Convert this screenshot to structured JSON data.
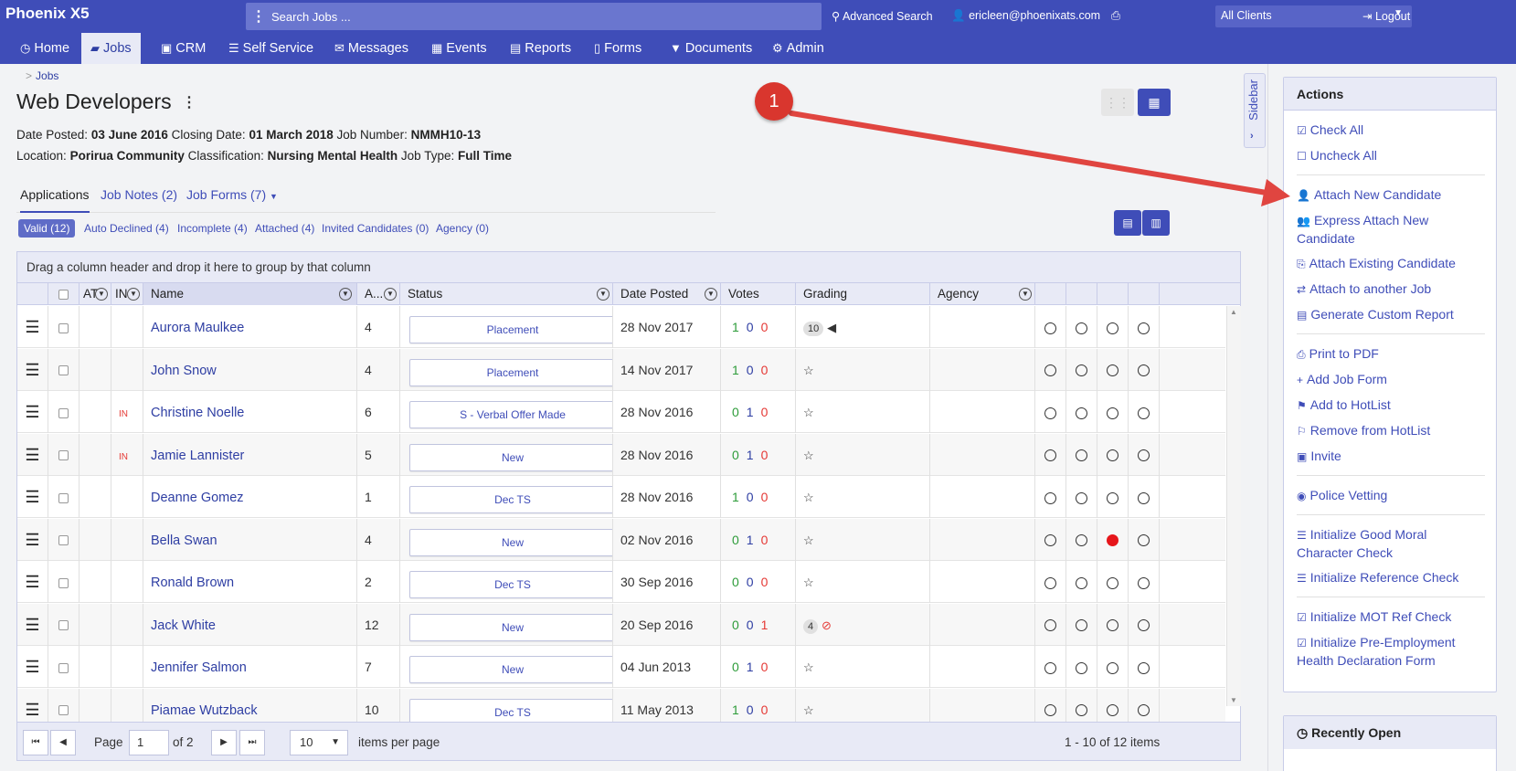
{
  "app": {
    "brand": "Phoenix X5",
    "search_placeholder": "Search Jobs ...",
    "advanced_search": "Advanced Search",
    "user": "ericleen@phoenixats.com",
    "client_select": "All Clients",
    "logout": "Logout"
  },
  "nav": [
    "Home",
    "Jobs",
    "CRM",
    "Self Service",
    "Messages",
    "Events",
    "Reports",
    "Forms",
    "Documents",
    "Admin"
  ],
  "breadcrumb": "Jobs",
  "job": {
    "title": "Web Developers",
    "date_posted_label": "Date Posted:",
    "date_posted": "03 June 2016",
    "closing_date_label": "Closing Date:",
    "closing_date": "01 March 2018",
    "job_number_label": "Job Number:",
    "job_number": "NMMH10-13",
    "location_label": "Location:",
    "location": "Porirua Community",
    "classification_label": "Classification:",
    "classification": "Nursing Mental Health",
    "job_type_label": "Job Type:",
    "job_type": "Full Time"
  },
  "sidebar_tab": "Sidebar",
  "tabs": [
    "Applications",
    "Job Notes (2)",
    "Job Forms (7)"
  ],
  "filters": [
    "Valid (12)",
    "Auto Declined (4)",
    "Incomplete (4)",
    "Attached (4)",
    "Invited Candidates (0)",
    "Agency (0)"
  ],
  "grid": {
    "group_hint": "Drag a column header and drop it here to group by that column",
    "headers": {
      "at": "AT",
      "in": "IN",
      "name": "Name",
      "a": "A...",
      "status": "Status",
      "date_posted": "Date Posted",
      "votes": "Votes",
      "grading": "Grading",
      "agency": "Agency"
    },
    "rows": [
      {
        "in": "",
        "name": "Aurora Maulkee",
        "a": "4",
        "status": "Placement",
        "date": "28 Nov 2017",
        "votes": [
          "1",
          "0",
          "0"
        ],
        "grade": "10",
        "grade_icon": "megaphone-icon",
        "radios": [
          false,
          false,
          false,
          false
        ]
      },
      {
        "in": "",
        "name": "John Snow",
        "a": "4",
        "status": "Placement",
        "date": "14 Nov 2017",
        "votes": [
          "1",
          "0",
          "0"
        ],
        "grade": "",
        "grade_icon": "star-icon",
        "radios": [
          false,
          false,
          false,
          false
        ]
      },
      {
        "in": "IN",
        "name": "Christine Noelle",
        "a": "6",
        "status": "S - Verbal Offer Made",
        "date": "28 Nov 2016",
        "votes": [
          "0",
          "1",
          "0"
        ],
        "grade": "",
        "grade_icon": "star-icon",
        "radios": [
          false,
          false,
          false,
          false
        ]
      },
      {
        "in": "IN",
        "name": "Jamie Lannister",
        "a": "5",
        "status": "New",
        "date": "28 Nov 2016",
        "votes": [
          "0",
          "1",
          "0"
        ],
        "grade": "",
        "grade_icon": "star-icon",
        "radios": [
          false,
          false,
          false,
          false
        ]
      },
      {
        "in": "",
        "name": "Deanne Gomez",
        "a": "1",
        "status": "Dec TS",
        "date": "28 Nov 2016",
        "votes": [
          "1",
          "0",
          "0"
        ],
        "grade": "",
        "grade_icon": "star-icon",
        "radios": [
          false,
          false,
          false,
          false
        ]
      },
      {
        "in": "",
        "name": "Bella Swan",
        "a": "4",
        "status": "New",
        "date": "02 Nov 2016",
        "votes": [
          "0",
          "1",
          "0"
        ],
        "grade": "",
        "grade_icon": "star-icon",
        "radios": [
          false,
          false,
          true,
          false
        ]
      },
      {
        "in": "",
        "name": "Ronald Brown",
        "a": "2",
        "status": "Dec TS",
        "date": "30 Sep 2016",
        "votes": [
          "0",
          "0",
          "0"
        ],
        "grade": "",
        "grade_icon": "star-icon",
        "radios": [
          false,
          false,
          false,
          false
        ]
      },
      {
        "in": "",
        "name": "Jack White",
        "a": "12",
        "status": "New",
        "date": "20 Sep 2016",
        "votes": [
          "0",
          "0",
          "1"
        ],
        "grade": "4",
        "grade_icon": "ban-icon",
        "radios": [
          false,
          false,
          false,
          false
        ]
      },
      {
        "in": "",
        "name": "Jennifer Salmon",
        "a": "7",
        "status": "New",
        "date": "04 Jun 2013",
        "votes": [
          "0",
          "1",
          "0"
        ],
        "grade": "",
        "grade_icon": "star-icon",
        "radios": [
          false,
          false,
          false,
          false
        ]
      },
      {
        "in": "",
        "name": "Piamae Wutzback",
        "a": "10",
        "status": "Dec TS",
        "date": "11 May 2013",
        "votes": [
          "1",
          "0",
          "0"
        ],
        "grade": "",
        "grade_icon": "star-icon",
        "radios": [
          false,
          false,
          false,
          false
        ]
      }
    ],
    "pager": {
      "page_label": "Page",
      "page": "1",
      "of": "of 2",
      "ipp": "10",
      "ipp_label": "items per page",
      "summary": "1 - 10 of 12 items"
    }
  },
  "actions": {
    "title": "Actions",
    "groups": [
      [
        {
          "label": "Check All",
          "icon": "check-square-icon"
        },
        {
          "label": "Uncheck All",
          "icon": "square-icon"
        }
      ],
      [
        {
          "label": "Attach New Candidate",
          "icon": "user-icon"
        },
        {
          "label": "Express Attach New Candidate",
          "icon": "users-icon"
        },
        {
          "label": "Attach Existing Candidate",
          "icon": "paperclip-icon"
        },
        {
          "label": "Attach to another Job",
          "icon": "exchange-icon"
        },
        {
          "label": "Generate Custom Report",
          "icon": "report-icon"
        }
      ],
      [
        {
          "label": "Print to PDF",
          "icon": "print-icon"
        },
        {
          "label": "Add Job Form",
          "icon": "plus-icon"
        },
        {
          "label": "Add to HotList",
          "icon": "flag-icon"
        },
        {
          "label": "Remove from HotList",
          "icon": "flag-outline-icon"
        },
        {
          "label": "Invite",
          "icon": "briefcase-icon"
        }
      ],
      [
        {
          "label": "Police Vetting",
          "icon": "eye-icon"
        }
      ],
      [
        {
          "label": "Initialize Good Moral Character Check",
          "icon": "list-icon"
        },
        {
          "label": "Initialize Reference Check",
          "icon": "list-icon"
        }
      ],
      [
        {
          "label": "Initialize MOT Ref Check",
          "icon": "check-square-icon"
        },
        {
          "label": "Initialize Pre-Employment Health Declaration Form",
          "icon": "check-square-icon"
        }
      ]
    ]
  },
  "recently_open": "Recently Open",
  "callout": "1",
  "colors": {
    "primary": "#3f4db8",
    "accent_red": "#d9362e",
    "vote_green": "#2e9c3a",
    "vote_red": "#e53935"
  }
}
